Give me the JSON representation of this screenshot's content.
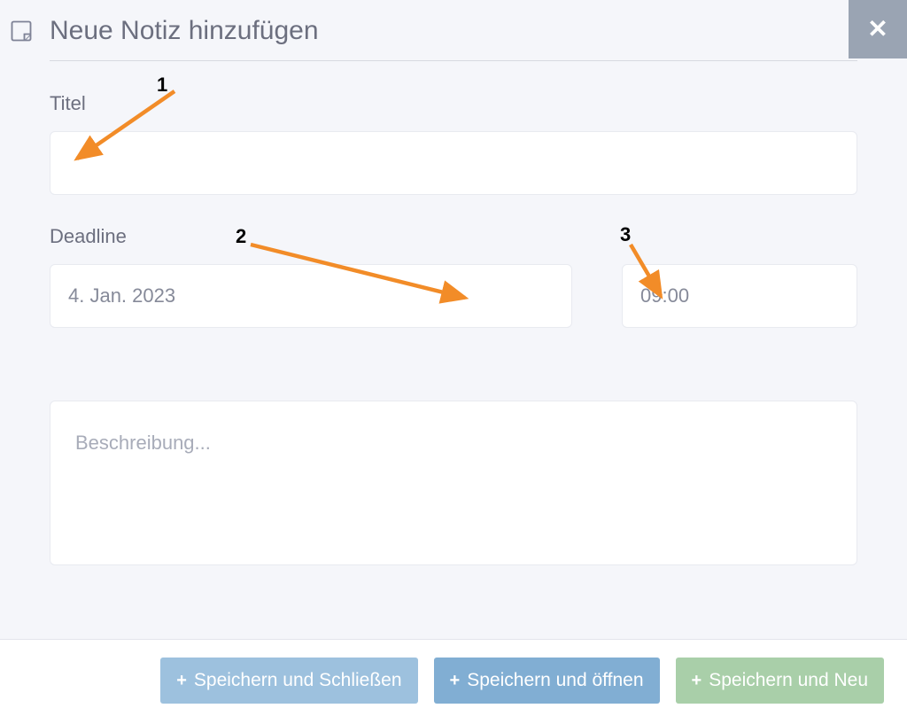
{
  "header": {
    "title": "Neue Notiz hinzufügen"
  },
  "fields": {
    "title_label": "Titel",
    "title_value": "",
    "deadline_label": "Deadline",
    "date_value": "4. Jan. 2023",
    "time_value": "09:00",
    "description_placeholder": "Beschreibung..."
  },
  "buttons": {
    "save_close": "Speichern und Schließen",
    "save_open": "Speichern und öffnen",
    "save_new": "Speichern und Neu"
  },
  "annotations": {
    "a1": "1",
    "a2": "2",
    "a3": "3"
  }
}
